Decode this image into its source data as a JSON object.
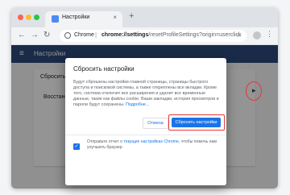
{
  "tab": {
    "title": "Настройки",
    "close": "×",
    "new_tab": "+"
  },
  "toolbar": {
    "back": "←",
    "forward": "→",
    "reload": "↻",
    "host": "Chrome",
    "separator": "|",
    "url_path_bold": "chrome://settings",
    "url_path_rest": "/resetProfileSettings?origin=userclick",
    "star": "☆",
    "menu": "⋮"
  },
  "page": {
    "hamburger": "≡",
    "title": "Настройки",
    "card_heading": "Сбросить настр",
    "card_item": "Восстано",
    "ellipsis_dot": "▸"
  },
  "dialog": {
    "title": "Сбросить настройки",
    "body": "Будут сброшены настройки главной страницы, страницы быстрого доступа и поисковой системы, а также откреплены все вкладки. Кроме того, система отключит все расширения и удалит все временные данные, такие как файлы cookie. Ваши закладки, история просмотров и пароли будут сохранены.",
    "link": "Подробне...",
    "cancel_label": "Отмена",
    "reset_label": "Сбросить настройки",
    "footer_prefix": "Отправьте отчет о ",
    "footer_link": "текущих настройках Chrome",
    "footer_suffix": ", чтобы помочь нам улучшить браузер",
    "checkbox_mark": "✓"
  },
  "colors": {
    "header": "#2c4a7c",
    "accent": "#1a73e8",
    "annotation": "#e53935"
  }
}
